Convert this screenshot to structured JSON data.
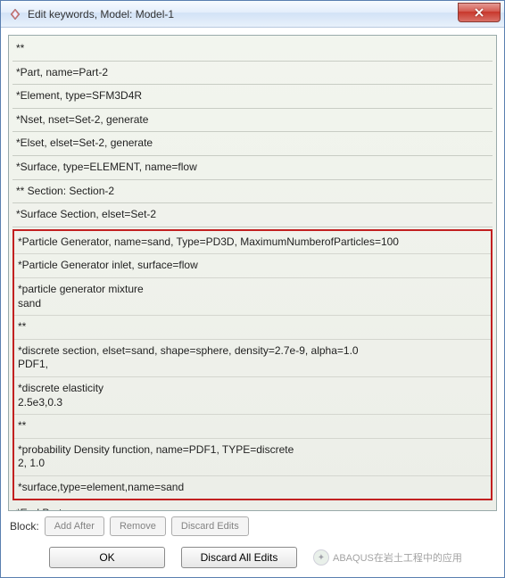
{
  "window": {
    "title": "Edit keywords, Model: Model-1"
  },
  "keywords": {
    "top": [
      "**",
      "*Part, name=Part-2",
      "*Element, type=SFM3D4R",
      "*Nset, nset=Set-2, generate",
      "*Elset, elset=Set-2, generate",
      "*Surface, type=ELEMENT, name=flow",
      "** Section: Section-2",
      "*Surface Section, elset=Set-2"
    ],
    "highlighted": [
      "*Particle Generator, name=sand, Type=PD3D, MaximumNumberofParticles=100",
      "*Particle Generator inlet, surface=flow",
      "*particle generator mixture\nsand",
      "**",
      "*discrete section, elset=sand, shape=sphere, density=2.7e-9, alpha=1.0\nPDF1,",
      "*discrete elasticity\n2.5e3,0.3",
      "**",
      "*probability Density function, name=PDF1, TYPE=discrete\n2, 1.0",
      "*surface,type=element,name=sand"
    ],
    "bottom": [
      "*End Part"
    ]
  },
  "block_row": {
    "label": "Block:",
    "add_after": "Add After",
    "remove": "Remove",
    "discard_edits": "Discard Edits"
  },
  "footer": {
    "ok": "OK",
    "discard_all": "Discard All Edits"
  },
  "watermark": {
    "text": "ABAQUS在岩土工程中的应用"
  }
}
